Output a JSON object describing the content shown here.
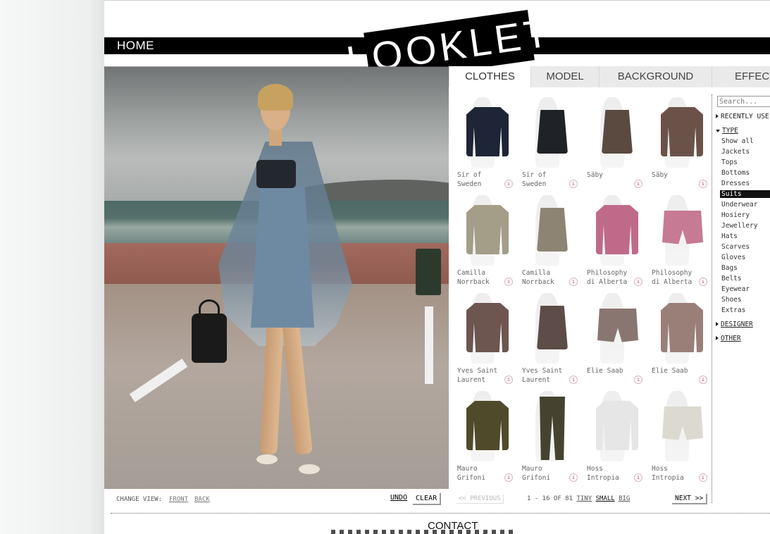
{
  "nav": {
    "home": "HOME",
    "logo": "LOOKLET",
    "contact": "CONTACT"
  },
  "tabs": [
    "CLOTHES",
    "MODEL",
    "BACKGROUND",
    "EFFECT"
  ],
  "view": {
    "label": "CHANGE VIEW:",
    "front": "FRONT",
    "back": "BACK",
    "undo": "UNDO",
    "clear": "CLEAR"
  },
  "search": {
    "placeholder": "Search..."
  },
  "sidebar": {
    "recently_used": "RECENTLY USE",
    "type": "TYPE",
    "items": [
      "Show all",
      "Jackets",
      "Tops",
      "Bottoms",
      "Dresses",
      "Suits",
      "Underwear",
      "Hosiery",
      "Jewellery",
      "Hats",
      "Scarves",
      "Gloves",
      "Bags",
      "Belts",
      "Eyewear",
      "Shoes",
      "Extras"
    ],
    "selected": "Suits",
    "designer": "DESIGNER",
    "other": "OTHER"
  },
  "products": [
    {
      "name": "Sir of Sweden",
      "garment": "jacket",
      "color": "#1e2536"
    },
    {
      "name": "Sir of Sweden",
      "garment": "skirt",
      "color": "#1f2226"
    },
    {
      "name": "Säby",
      "garment": "skirt",
      "color": "#5a4a40"
    },
    {
      "name": "Säby",
      "garment": "jacket",
      "color": "#6b5249"
    },
    {
      "name": "Camilla Norrback",
      "garment": "jacket",
      "color": "#a49d88"
    },
    {
      "name": "Camilla Norrback",
      "garment": "skirt",
      "color": "#8d8474"
    },
    {
      "name": "Philosophy di Alberta Ferretti",
      "garment": "jacket",
      "color": "#c06a8a"
    },
    {
      "name": "Philosophy di Alberta Ferretti",
      "garment": "shorts",
      "color": "#c77a93"
    },
    {
      "name": "Yves Saint Laurent",
      "garment": "jacket",
      "color": "#6d5550"
    },
    {
      "name": "Yves Saint Laurent",
      "garment": "skirt",
      "color": "#5d4c47"
    },
    {
      "name": "Elie Saab",
      "garment": "shorts",
      "color": "#8a7670"
    },
    {
      "name": "Elie Saab",
      "garment": "jacket",
      "color": "#9a7f78"
    },
    {
      "name": "Mauro Grifoni",
      "garment": "jacket",
      "color": "#4f4a2a"
    },
    {
      "name": "Mauro Grifoni",
      "garment": "trousers",
      "color": "#454330"
    },
    {
      "name": "Hoss Intropia",
      "garment": "jacket",
      "color": "#e6e6e6"
    },
    {
      "name": "Hoss Intropia",
      "garment": "shorts",
      "color": "#dcdad0"
    }
  ],
  "pager": {
    "previous": "<< PREVIOUS",
    "count": "1 - 16 OF 81",
    "sizes": [
      "TINY",
      "SMALL",
      "BIG"
    ],
    "next": "NEXT >>"
  }
}
